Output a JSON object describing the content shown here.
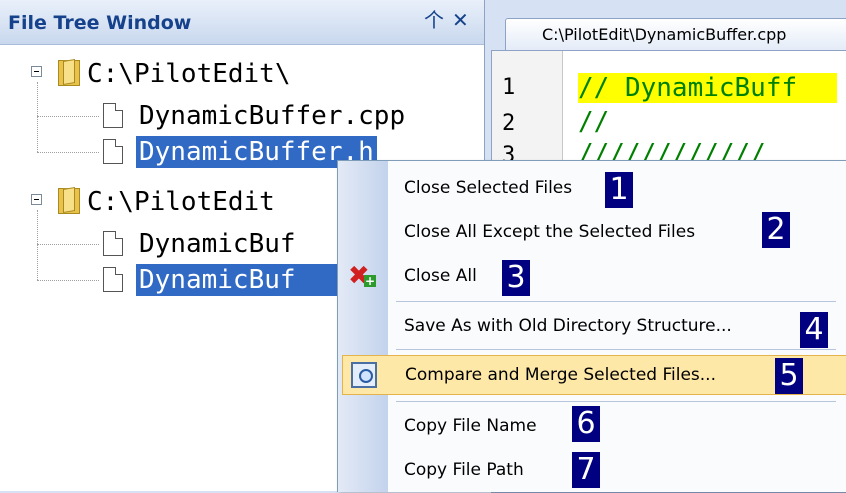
{
  "tree_panel": {
    "title": "File Tree Window",
    "pin_icon": "pin-icon",
    "close_icon": "close-icon",
    "nodes": [
      {
        "type": "folder",
        "label": "C:\\PilotEdit\\"
      },
      {
        "type": "file",
        "label": "DynamicBuffer.cpp"
      },
      {
        "type": "file",
        "label": "DynamicBuffer.h",
        "selected": true
      },
      {
        "type": "folder",
        "label": "C:\\PilotEdit"
      },
      {
        "type": "file",
        "label": "DynamicBuf"
      },
      {
        "type": "file",
        "label": "DynamicBuf",
        "selected": true
      }
    ]
  },
  "editor": {
    "tab_label": "C:\\PilotEdit\\DynamicBuffer.cpp",
    "line_numbers": [
      "1",
      "2",
      "3"
    ],
    "code_lines": [
      "// DynamicBuff",
      "//",
      "////////////"
    ]
  },
  "context_menu": {
    "items": [
      {
        "label": "Close Selected Files",
        "badge": "1"
      },
      {
        "label": "Close All Except the Selected Files",
        "badge": "2"
      },
      {
        "label": "Close All",
        "badge": "3",
        "icon": "close-all-icon"
      },
      {
        "label": "Save As with Old Directory Structure...",
        "badge": "4"
      },
      {
        "label": "Compare and Merge Selected Files...",
        "badge": "5",
        "icon": "compare-icon",
        "highlighted": true
      },
      {
        "label": "Copy File Name",
        "badge": "6"
      },
      {
        "label": "Copy File Path",
        "badge": "7"
      }
    ]
  },
  "colors": {
    "selection": "#316ac5",
    "title_text": "#15428b",
    "menu_highlight": "#fde8a8",
    "badge_bg": "#000080",
    "code_highlight": "#ffff00",
    "comment": "#008000"
  }
}
